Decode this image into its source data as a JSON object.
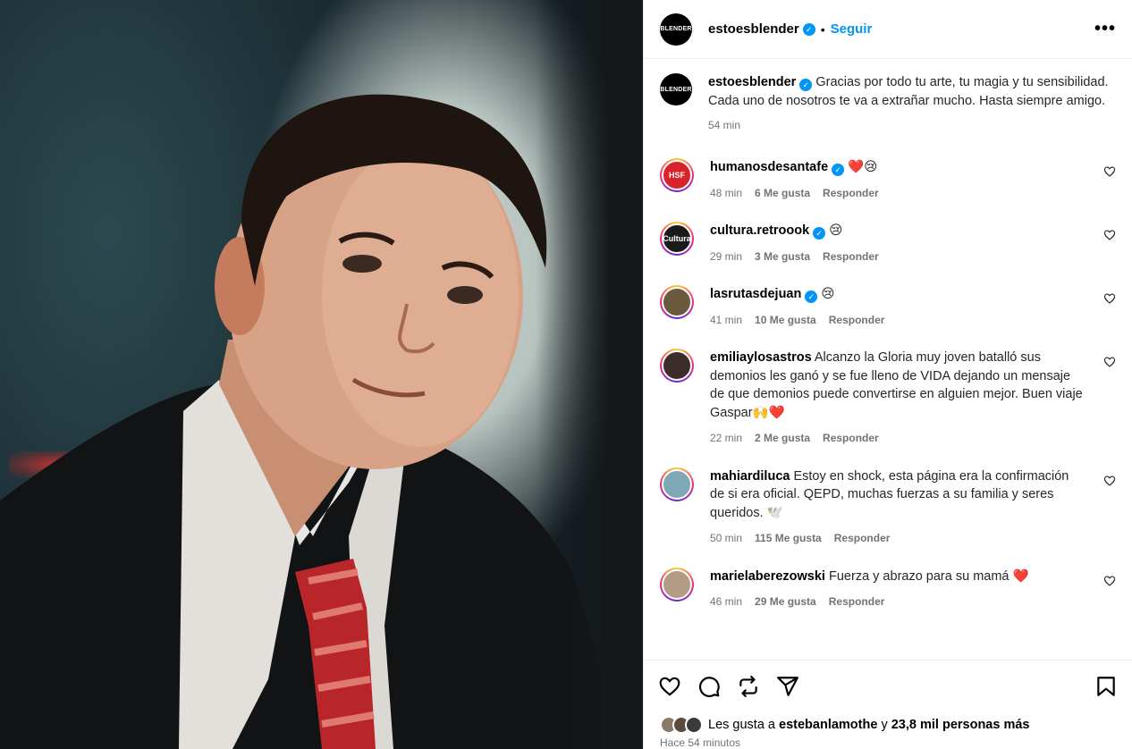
{
  "post": {
    "author": "estoesblender",
    "avatar_text": "BLENDER",
    "follow_label": "Seguir",
    "more_label": "•••",
    "caption": "Gracias por todo tu arte, tu magia y tu sensibilidad. Cada uno de nosotros te va a extrañar mucho. Hasta siempre amigo.",
    "caption_time": "54 min"
  },
  "comments": [
    {
      "user": "humanosdesantafe",
      "verified": true,
      "text": "❤️😢",
      "time": "48 min",
      "likes": "6 Me gusta",
      "reply": "Responder",
      "avatar_text": "HSF",
      "avatar_color": "#d9232a"
    },
    {
      "user": "cultura.retroook",
      "verified": true,
      "text": "😢",
      "time": "29 min",
      "likes": "3 Me gusta",
      "reply": "Responder",
      "avatar_text": "Cultura",
      "avatar_color": "#1a1a1a"
    },
    {
      "user": "lasrutasdejuan",
      "verified": true,
      "text": "😢",
      "time": "41 min",
      "likes": "10 Me gusta",
      "reply": "Responder",
      "avatar_text": "",
      "avatar_color": "#6b5a3e"
    },
    {
      "user": "emiliaylosastros",
      "verified": false,
      "text": "Alcanzo la Gloria muy joven batalló sus demonios les ganó y se fue lleno de VIDA dejando un mensaje de que demonios puede convertirse en alguien mejor. Buen viaje Gaspar🙌❤️",
      "time": "22 min",
      "likes": "2 Me gusta",
      "reply": "Responder",
      "avatar_text": "",
      "avatar_color": "#3b2e2a"
    },
    {
      "user": "mahiardiluca",
      "verified": false,
      "text": "Estoy en shock, esta página era la confirmación de si era oficial. QEPD, muchas fuerzas a su familia y seres queridos. 🕊️",
      "time": "50 min",
      "likes": "115 Me gusta",
      "reply": "Responder",
      "avatar_text": "",
      "avatar_color": "#7fa7b5"
    },
    {
      "user": "marielaberezowski",
      "verified": false,
      "text": "Fuerza y abrazo para su mamá ❤️",
      "time": "46 min",
      "likes": "29 Me gusta",
      "reply": "Responder",
      "avatar_text": "",
      "avatar_color": "#b39b86"
    }
  ],
  "likes_summary": {
    "prefix": "Les gusta a",
    "user": "estebanlamothe",
    "joiner": "y",
    "rest": "23,8 mil personas más"
  },
  "posted_time": "Hace 54 minutos",
  "colors": {
    "accent": "#0095f6",
    "verified": "#0095f6",
    "muted": "#737373"
  }
}
